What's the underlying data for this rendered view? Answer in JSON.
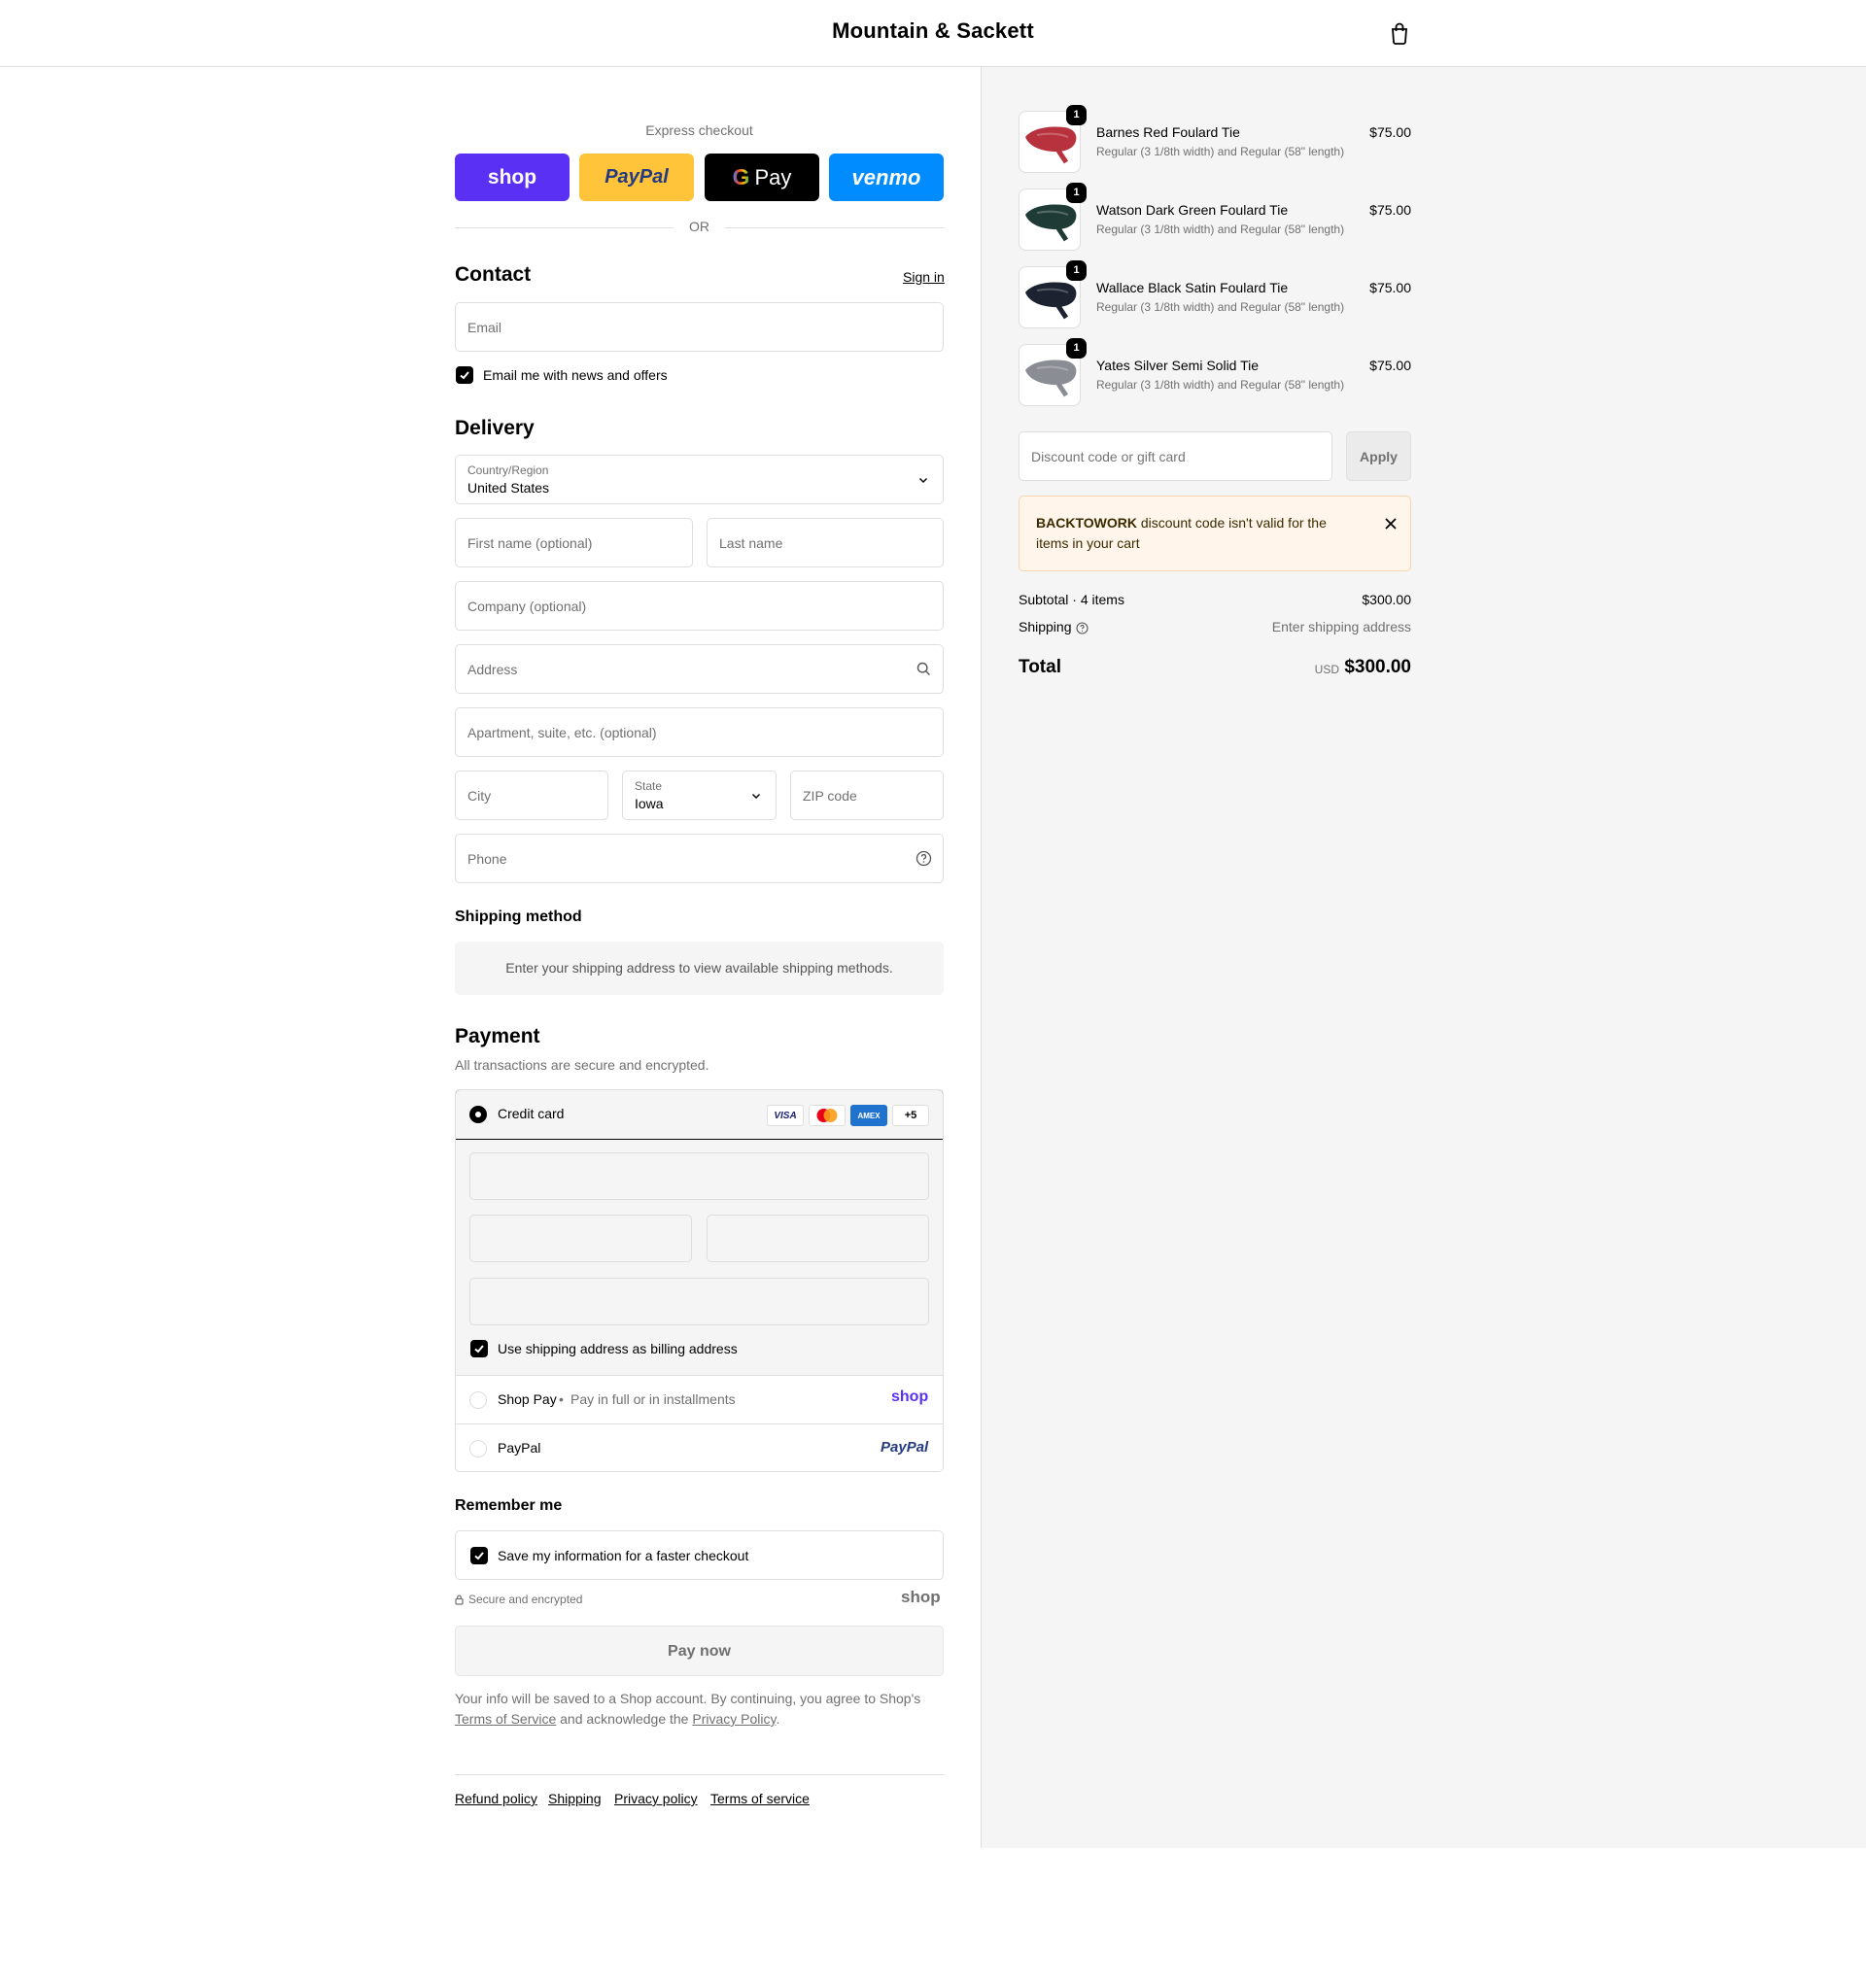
{
  "header": {
    "brand": "Mountain & Sackett"
  },
  "express": {
    "title": "Express checkout",
    "buttons": {
      "shop": "shop",
      "paypal": "PayPal",
      "gpay": "Pay",
      "venmo": "venmo"
    },
    "or": "OR"
  },
  "contact": {
    "title": "Contact",
    "sign_in": "Sign in",
    "email_placeholder": "Email",
    "news_label": "Email me with news and offers",
    "news_checked": true
  },
  "delivery": {
    "title": "Delivery",
    "country_label": "Country/Region",
    "country_value": "United States",
    "first_name_placeholder": "First name (optional)",
    "last_name_placeholder": "Last name",
    "company_placeholder": "Company (optional)",
    "address_placeholder": "Address",
    "apartment_placeholder": "Apartment, suite, etc. (optional)",
    "city_placeholder": "City",
    "state_label": "State",
    "state_value": "Iowa",
    "zip_placeholder": "ZIP code",
    "phone_placeholder": "Phone"
  },
  "shipping_method": {
    "title": "Shipping method",
    "message": "Enter your shipping address to view available shipping methods."
  },
  "payment": {
    "title": "Payment",
    "subtitle": "All transactions are secure and encrypted.",
    "credit_card": "Credit card",
    "card_logos": {
      "visa": "VISA",
      "amex": "AMEX",
      "more": "+5"
    },
    "billing_label": "Use shipping address as billing address",
    "shop_pay": "Shop Pay",
    "shop_pay_desc": "Pay in full or in installments",
    "shop_logo": "shop",
    "paypal": "PayPal",
    "paypal_logo": "PayPal"
  },
  "remember": {
    "title": "Remember me",
    "save_label": "Save my information for a faster checkout",
    "secure": "Secure and encrypted",
    "shop_logo": "shop"
  },
  "pay_now": "Pay now",
  "legal": {
    "text1": "Your info will be saved to a Shop account. By continuing, you agree to Shop's",
    "terms": "Terms of Service",
    "text2": "and acknowledge the",
    "privacy": "Privacy Policy",
    "text3": "."
  },
  "footer": {
    "refund": "Refund policy",
    "shipping": "Shipping",
    "privacy": "Privacy policy",
    "terms": "Terms of service"
  },
  "cart": {
    "items": [
      {
        "name": "Barnes Red Foulard Tie",
        "variant": "Regular (3 1/8th width) and Regular (58\" length)",
        "price": "$75.00",
        "qty": "1",
        "color": "#b8323d"
      },
      {
        "name": "Watson Dark Green Foulard Tie",
        "variant": "Regular (3 1/8th width) and Regular (58\" length)",
        "price": "$75.00",
        "qty": "1",
        "color": "#1f3b36"
      },
      {
        "name": "Wallace Black Satin Foulard Tie",
        "variant": "Regular (3 1/8th width) and Regular (58\" length)",
        "price": "$75.00",
        "qty": "1",
        "color": "#1c2230"
      },
      {
        "name": "Yates Silver Semi Solid Tie",
        "variant": "Regular (3 1/8th width) and Regular (58\" length)",
        "price": "$75.00",
        "qty": "1",
        "color": "#8a8d94"
      }
    ],
    "discount_placeholder": "Discount code or gift card",
    "apply": "Apply",
    "notice_code": "BACKTOWORK",
    "notice_text": "discount code isn't valid for the items in your cart",
    "subtotal_label": "Subtotal · 4 items",
    "subtotal_value": "$300.00",
    "shipping_label": "Shipping",
    "shipping_value": "Enter shipping address",
    "total_label": "Total",
    "currency": "USD",
    "total_value": "$300.00"
  }
}
